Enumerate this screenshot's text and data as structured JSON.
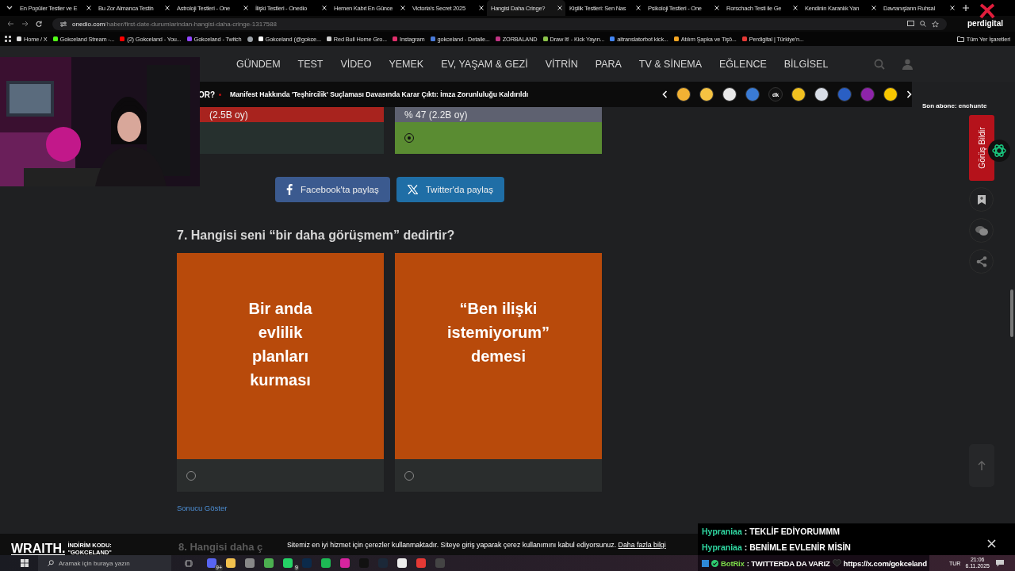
{
  "browser": {
    "tabs": [
      {
        "title": "En Popüler Testler ve E",
        "selected": false
      },
      {
        "title": "Bu Zor Almanca Testin",
        "selected": false
      },
      {
        "title": "Astroloji Testleri - One",
        "selected": false
      },
      {
        "title": "İlişki Testleri - Onedio",
        "selected": false
      },
      {
        "title": "Hemen Kabıt En Günce",
        "selected": false
      },
      {
        "title": "Victoria's Secret 2025",
        "selected": false
      },
      {
        "title": "Hangisi Daha Cringe?",
        "selected": true
      },
      {
        "title": "Kişilik Testleri: Sen Nas",
        "selected": false
      },
      {
        "title": "Psikoloji Testleri - One",
        "selected": false
      },
      {
        "title": "Rorschach Testi ile Ge",
        "selected": false
      },
      {
        "title": "Kendinin Karanlık Yan",
        "selected": false
      },
      {
        "title": "Davranışların Ruhsal",
        "selected": false
      }
    ],
    "address": {
      "host": "onedio.com",
      "path": "/haber/first-date-durumlarindan-hangisi-daha-cringe-1317588"
    },
    "bookmarks": [
      {
        "label": "Home / X",
        "color": "#e0e0e0"
      },
      {
        "label": "Gokceland Stream -...",
        "color": "#53fc18"
      },
      {
        "label": "(2) Gokceland - You...",
        "color": "#ff0000"
      },
      {
        "label": "Gokceland - Twitch",
        "color": "#9146ff"
      },
      {
        "color": "#9aa0a6"
      },
      {
        "label": "Gokceland (@gokce...",
        "color": "#ffffff"
      },
      {
        "label": "Red Bull Home Gro...",
        "color": "#d0d0d0"
      },
      {
        "label": "Instagram",
        "color": "#e1306c"
      },
      {
        "label": "gokceland - Detaile...",
        "color": "#4a7bd9"
      },
      {
        "label": "ZORBALAND",
        "color": "#c13584"
      },
      {
        "label": "Draw It! - Kick Yayın...",
        "color": "#8bc34a"
      },
      {
        "label": "aitranslatorbot kick...",
        "color": "#4285f4"
      },
      {
        "label": "Atılım Şapka ve Tişö...",
        "color": "#f5a623"
      },
      {
        "label": "Perdigital | Türkiye'n...",
        "color": "#e53935"
      }
    ],
    "all_bookmarks": "Tüm Yer İşaretleri"
  },
  "site": {
    "nav": [
      "GÜNDEM",
      "TEST",
      "VİDEO",
      "YEMEK",
      "EV, YAŞAM & GEZİ",
      "VİTRİN",
      "PARA",
      "TV & SİNEMA",
      "EĞLENCE",
      "BİLGİSEL"
    ],
    "ticker": {
      "cut_title": "OR?",
      "headline": "Manifest Hakkında 'Teşhircilik' Suçlaması Davasında Karar Çıktı: İmza Zorunluluğu Kaldırıldı"
    },
    "category_icons": [
      {
        "color": "#f2b233"
      },
      {
        "color": "#f5c342"
      },
      {
        "color": "#e8e8e8"
      },
      {
        "color": "#3a7bd5"
      },
      {
        "color": "#111111",
        "label": "dk"
      },
      {
        "color": "#f0c020"
      },
      {
        "color": "#d8dde6"
      },
      {
        "color": "#2a5fc4"
      },
      {
        "color": "#8e24aa"
      },
      {
        "color": "#f7c600"
      }
    ]
  },
  "previous_poll": {
    "options": [
      {
        "result": "(2.5B oy)",
        "color": "#a8231e",
        "selected": false
      },
      {
        "result": "% 47 (2.2B oy)",
        "color": "#5e6170",
        "selected": true
      }
    ]
  },
  "share": [
    {
      "kind": "facebook",
      "label": "Facebook'ta paylaş"
    },
    {
      "kind": "twitter",
      "label": "Twitter'da paylaş"
    }
  ],
  "question": {
    "title": "7. Hangisi seni “bir daha görüşmem” dedirtir?",
    "options": [
      {
        "text": "Bir anda evlilik planları kurması",
        "selected": false
      },
      {
        "text": "“Ben ilişki istemiyorum” demesi",
        "selected": false
      }
    ],
    "show_result": "Sonucu Göster"
  },
  "next_question": "8. Hangisi daha ç",
  "feedback": "Görüş Bildir",
  "cookie": {
    "text": "Sitemiz en iyi hizmet için çerezler kullanmaktadır. Siteye giriş yaparak çerez kullanımını kabul ediyorsunuz.",
    "link": "Daha fazla bilgi"
  },
  "stream": {
    "last_sub": "Son abone: enchunte",
    "logo": "perdigital",
    "sponsor": {
      "brand": "WRAITH.",
      "code_label": "İNDİRİM KODU:",
      "code": "\"GOKCELAND\""
    },
    "chat": [
      {
        "kind": "viewer",
        "user": "Hypraniaa",
        "message": ": TEKLİF EDİYORUMMM"
      },
      {
        "kind": "viewer",
        "user": "Hypraniaa",
        "message": ": BENİMLE EVLENİR MİSİN"
      },
      {
        "kind": "bot",
        "user": "BotRix",
        "message": ": TWITTERDA DA VARIZ",
        "link": "https://x.com/gokceland"
      }
    ]
  },
  "taskbar": {
    "search_placeholder": "Aramak için buraya yazın",
    "apps": [
      {
        "color": "#5865f2",
        "badge": "9+"
      },
      {
        "color": "#f2c14e"
      },
      {
        "color": "#888888"
      },
      {
        "color": "#4caf50"
      },
      {
        "color": "#25d366",
        "badge": "9"
      },
      {
        "color": "#0b2a4a"
      },
      {
        "color": "#1db954"
      },
      {
        "color": "#d6249f"
      },
      {
        "color": "#111111"
      },
      {
        "color": "#1b2838"
      },
      {
        "color": "#eeeeee"
      },
      {
        "color": "#e53935"
      },
      {
        "color": "#444444"
      }
    ],
    "lang": "TUR",
    "time": "21:06",
    "date": "6.11.2025"
  }
}
